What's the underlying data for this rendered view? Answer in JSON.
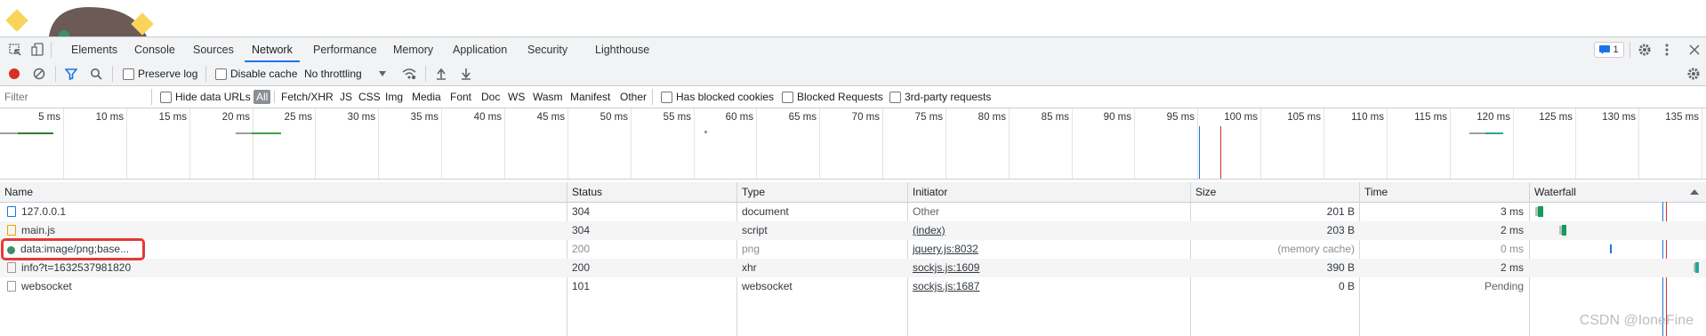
{
  "tabs": [
    "Elements",
    "Console",
    "Sources",
    "Network",
    "Performance",
    "Memory",
    "Application",
    "Security",
    "Lighthouse"
  ],
  "active_tab": "Network",
  "issues_badge": "1",
  "toolbar1": {
    "preserve_log": "Preserve log",
    "disable_cache": "Disable cache",
    "throttling": "No throttling"
  },
  "toolbar2": {
    "filter_placeholder": "Filter",
    "hide_data_urls": "Hide data URLs",
    "types": [
      "All",
      "Fetch/XHR",
      "JS",
      "CSS",
      "Img",
      "Media",
      "Font",
      "Doc",
      "WS",
      "Wasm",
      "Manifest",
      "Other"
    ],
    "has_blocked_cookies": "Has blocked cookies",
    "blocked_requests": "Blocked Requests",
    "third_party": "3rd-party requests"
  },
  "overview_ticks": [
    "5 ms",
    "10 ms",
    "15 ms",
    "20 ms",
    "25 ms",
    "30 ms",
    "35 ms",
    "40 ms",
    "45 ms",
    "50 ms",
    "55 ms",
    "60 ms",
    "65 ms",
    "70 ms",
    "75 ms",
    "80 ms",
    "85 ms",
    "90 ms",
    "95 ms",
    "100 ms",
    "105 ms",
    "110 ms",
    "115 ms",
    "120 ms",
    "125 ms",
    "130 ms",
    "135 ms"
  ],
  "columns": [
    "Name",
    "Status",
    "Type",
    "Initiator",
    "Size",
    "Time",
    "Waterfall"
  ],
  "rows": [
    {
      "name": "127.0.0.1",
      "status": "304",
      "type": "document",
      "initiator": "Other",
      "size": "201 B",
      "time": "3 ms"
    },
    {
      "name": "main.js",
      "status": "304",
      "type": "script",
      "initiator": "(index)",
      "size": "203 B",
      "time": "2 ms"
    },
    {
      "name": "data:image/png;base...",
      "status": "200",
      "type": "png",
      "initiator": "jquery.js:8032",
      "size": "(memory cache)",
      "time": "0 ms"
    },
    {
      "name": "info?t=1632537981820",
      "status": "200",
      "type": "xhr",
      "initiator": "sockjs.js:1609",
      "size": "390 B",
      "time": "2 ms"
    },
    {
      "name": "websocket",
      "status": "101",
      "type": "websocket",
      "initiator": "sockjs.js:1687",
      "size": "0 B",
      "time": "Pending"
    }
  ],
  "watermark": "CSDN @IoneFine",
  "colors": {
    "accent": "#1a73e8",
    "record": "#d93025",
    "highlight_box": "#e53935"
  }
}
